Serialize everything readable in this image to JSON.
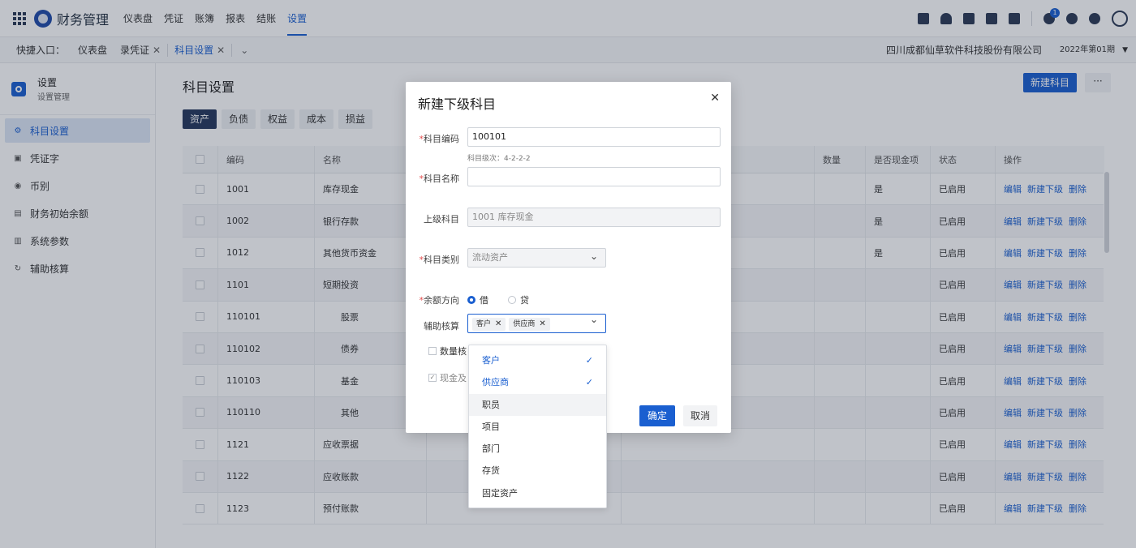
{
  "app": {
    "title": "财务管理"
  },
  "nav": [
    "仪表盘",
    "凭证",
    "账簿",
    "报表",
    "结账",
    "设置"
  ],
  "notifications": {
    "count": "1"
  },
  "quickbar": {
    "label": "快捷入口：",
    "tabs": [
      {
        "label": "仪表盘",
        "closable": false
      },
      {
        "label": "录凭证",
        "closable": true
      },
      {
        "label": "科目设置",
        "closable": true
      }
    ],
    "close_glyph": "✕",
    "company": "四川成都仙草软件科技股份有限公司",
    "period": "2022年第01期"
  },
  "sidebar": {
    "title": "设置",
    "subtitle": "设置管理",
    "items": [
      {
        "label": "科目设置",
        "icon": "gear-icon",
        "glyph": "⚙"
      },
      {
        "label": "凭证字",
        "icon": "voucher-icon",
        "glyph": "▣"
      },
      {
        "label": "币别",
        "icon": "currency-icon",
        "glyph": "◉"
      },
      {
        "label": "财务初始余额",
        "icon": "balance-icon",
        "glyph": "▤"
      },
      {
        "label": "系统参数",
        "icon": "params-icon",
        "glyph": "▥"
      },
      {
        "label": "辅助核算",
        "icon": "refresh-icon",
        "glyph": "↻"
      }
    ]
  },
  "main": {
    "title": "科目设置",
    "new_button": "新建科目",
    "more_button": "···",
    "type_tabs": [
      "资产",
      "负债",
      "权益",
      "成本",
      "损益"
    ]
  },
  "table": {
    "headers": {
      "code": "编码",
      "name": "名称",
      "qty": "数量",
      "cash": "是否现金项",
      "status": "状态",
      "ops": "操作"
    },
    "actions": {
      "edit": "编辑",
      "add_child": "新建下级",
      "delete": "删除"
    },
    "rows": [
      {
        "code": "1001",
        "name": "库存现金",
        "cash": "是",
        "status": "已启用"
      },
      {
        "code": "1002",
        "name": "银行存款",
        "cash": "是",
        "status": "已启用"
      },
      {
        "code": "1012",
        "name": "其他货币资金",
        "cash": "是",
        "status": "已启用"
      },
      {
        "code": "1101",
        "name": "短期投资",
        "cash": "",
        "status": "已启用"
      },
      {
        "code": "110101",
        "name": "股票",
        "cash": "",
        "status": "已启用"
      },
      {
        "code": "110102",
        "name": "债券",
        "cash": "",
        "status": "已启用"
      },
      {
        "code": "110103",
        "name": "基金",
        "cash": "",
        "status": "已启用"
      },
      {
        "code": "110110",
        "name": "其他",
        "cash": "",
        "status": "已启用"
      },
      {
        "code": "1121",
        "name": "应收票据",
        "cash": "",
        "status": "已启用"
      },
      {
        "code": "1122",
        "name": "应收账款",
        "cash": "",
        "status": "已启用"
      },
      {
        "code": "1123",
        "name": "预付账款",
        "cash": "",
        "status": "已启用"
      }
    ]
  },
  "modal": {
    "title": "新建下级科目",
    "close": "✕",
    "code_label": "科目编码",
    "code_value": "100101",
    "code_hint": "科目级次：4-2-2-2",
    "name_label": "科目名称",
    "name_value": "",
    "parent_label": "上级科目",
    "parent_value": "1001 库存现金",
    "category_label": "科目类别",
    "category_value": "流动资产",
    "direction_label": "余额方向",
    "direction_debit": "借",
    "direction_credit": "贷",
    "aux_label": "辅助核算",
    "aux_tags": [
      "客户",
      "供应商"
    ],
    "qty_label": "数量核",
    "cash_label": "现金及",
    "ok": "确定",
    "cancel": "取消"
  },
  "dropdown": {
    "options": [
      {
        "label": "客户",
        "selected": true
      },
      {
        "label": "供应商",
        "selected": true
      },
      {
        "label": "职员",
        "selected": false
      },
      {
        "label": "项目",
        "selected": false
      },
      {
        "label": "部门",
        "selected": false
      },
      {
        "label": "存货",
        "selected": false
      },
      {
        "label": "固定资产",
        "selected": false
      }
    ],
    "check_glyph": "✓"
  }
}
